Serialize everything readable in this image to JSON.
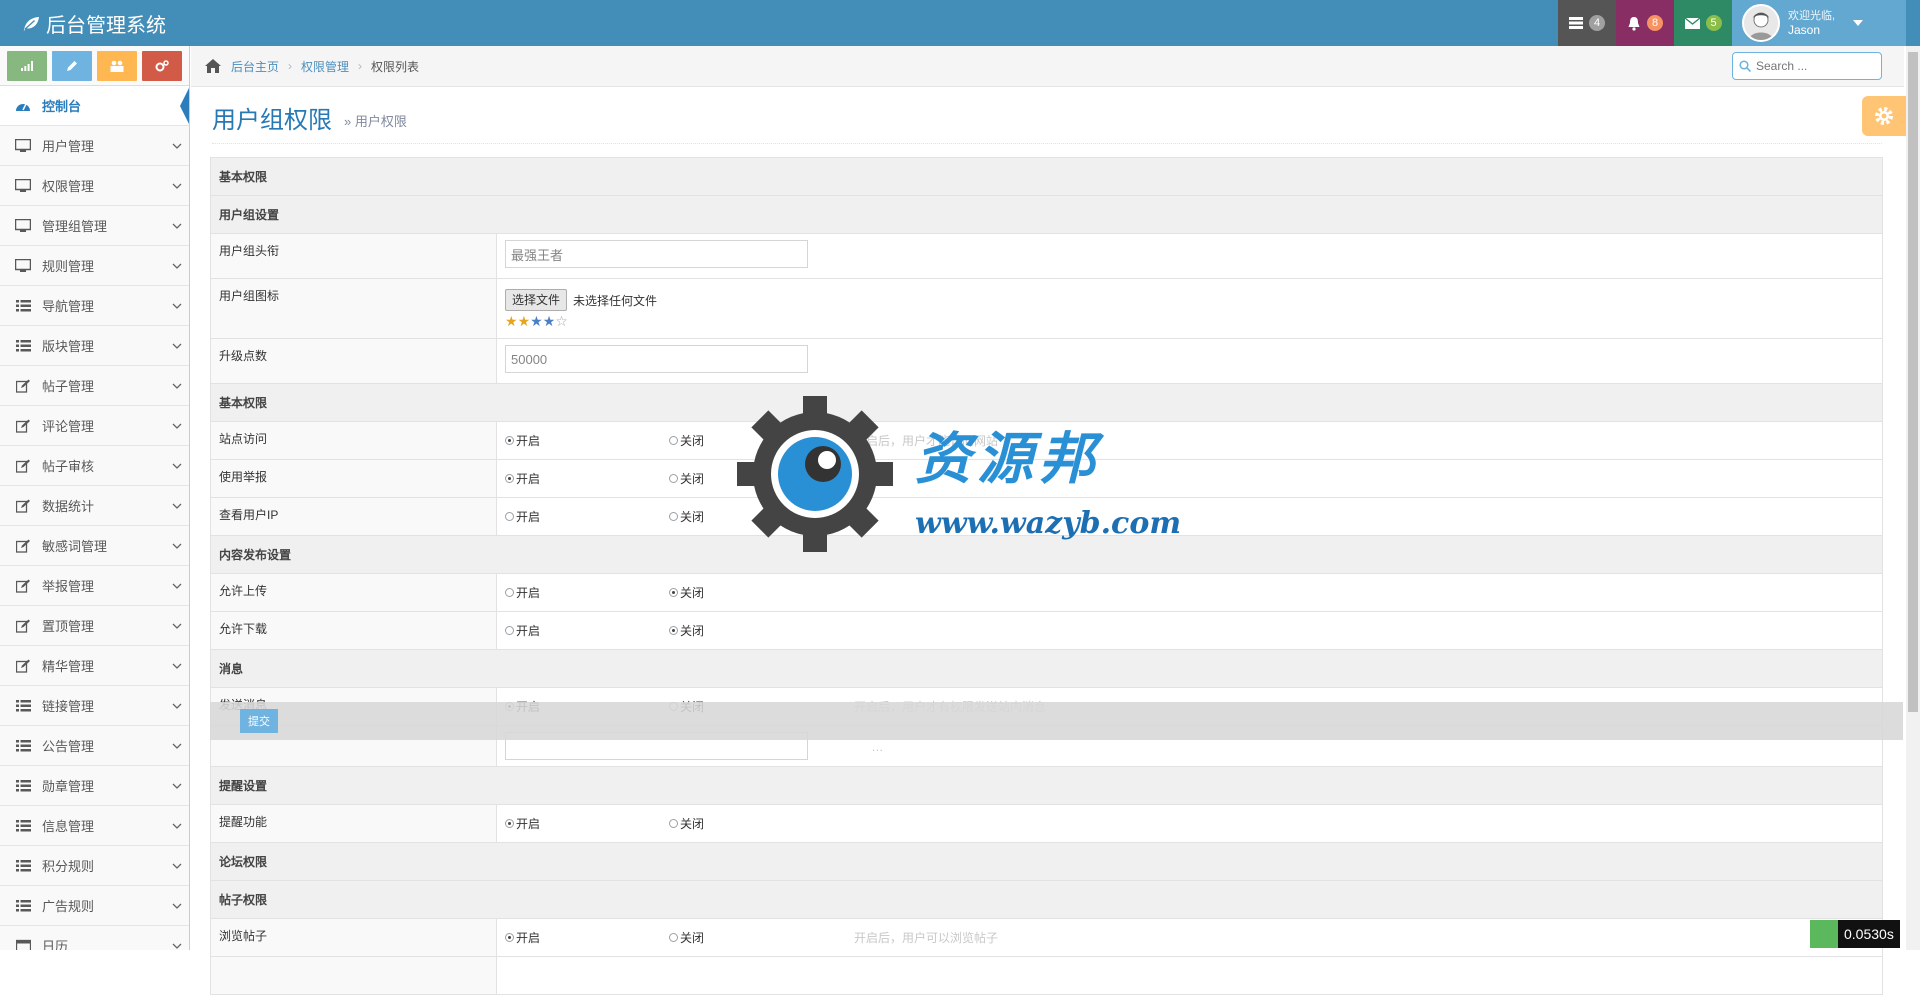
{
  "brand": "后台管理系统",
  "navbar": {
    "tasks_count": "4",
    "notifications_count": "8",
    "messages_count": "5",
    "welcome": "欢迎光临,",
    "username": "Jason"
  },
  "sidebar": {
    "items": [
      {
        "label": "控制台",
        "icon": "dashboard-icon",
        "active": true
      },
      {
        "label": "用户管理",
        "icon": "desktop-icon"
      },
      {
        "label": "权限管理",
        "icon": "desktop-icon"
      },
      {
        "label": "管理组管理",
        "icon": "desktop-icon"
      },
      {
        "label": "规则管理",
        "icon": "desktop-icon"
      },
      {
        "label": "导航管理",
        "icon": "list-icon"
      },
      {
        "label": "版块管理",
        "icon": "list-icon"
      },
      {
        "label": "帖子管理",
        "icon": "edit-icon"
      },
      {
        "label": "评论管理",
        "icon": "edit-icon"
      },
      {
        "label": "帖子审核",
        "icon": "edit-icon"
      },
      {
        "label": "数据统计",
        "icon": "edit-icon"
      },
      {
        "label": "敏感词管理",
        "icon": "edit-icon"
      },
      {
        "label": "举报管理",
        "icon": "edit-icon"
      },
      {
        "label": "置顶管理",
        "icon": "edit-icon"
      },
      {
        "label": "精华管理",
        "icon": "edit-icon"
      },
      {
        "label": "链接管理",
        "icon": "list-icon"
      },
      {
        "label": "公告管理",
        "icon": "list-icon"
      },
      {
        "label": "勋章管理",
        "icon": "list-icon"
      },
      {
        "label": "信息管理",
        "icon": "list-icon"
      },
      {
        "label": "积分规则",
        "icon": "list-icon"
      },
      {
        "label": "广告规则",
        "icon": "list-icon"
      },
      {
        "label": "日历",
        "icon": "calendar-icon"
      }
    ]
  },
  "breadcrumb": {
    "home": "后台主页",
    "parent": "权限管理",
    "current": "权限列表"
  },
  "search": {
    "placeholder": "Search ..."
  },
  "page": {
    "title": "用户组权限",
    "subtitle": "» 用户权限"
  },
  "form": {
    "section_basic": "基本权限",
    "sub_group_settings": "用户组设置",
    "group_title_label": "用户组头衔",
    "group_title_value": "最强王者",
    "group_icon_label": "用户组图标",
    "file_button": "选择文件",
    "file_none": "未选择任何文件",
    "stars_filled": 4,
    "stars_total": 5,
    "upgrade_label": "升级点数",
    "upgrade_value": "50000",
    "sub_basic": "基本权限",
    "site_access_label": "站点访问",
    "site_access_hint": "开启后，用户才能访问网站",
    "use_report_label": "使用举报",
    "view_ip_label": "查看用户IP",
    "sub_content": "内容发布设置",
    "allow_upload_label": "允许上传",
    "allow_download_label": "允许下载",
    "sub_message": "消息",
    "send_message_label": "发送消息",
    "send_message_hint": "开启后，用户才有权限发送站内消息",
    "hidden_row_hint": "…",
    "sub_remind": "提醒设置",
    "remind_label": "提醒功能",
    "section_forum": "论坛权限",
    "sub_post": "帖子权限",
    "browse_post_label": "浏览帖子",
    "browse_post_hint": "开启后，用户可以浏览帖子",
    "on": "开启",
    "off": "关闭",
    "submit": "提交"
  },
  "watermark": {
    "name": "资源邦",
    "url": "www.wazyb.com"
  },
  "timer": "0.0530s"
}
